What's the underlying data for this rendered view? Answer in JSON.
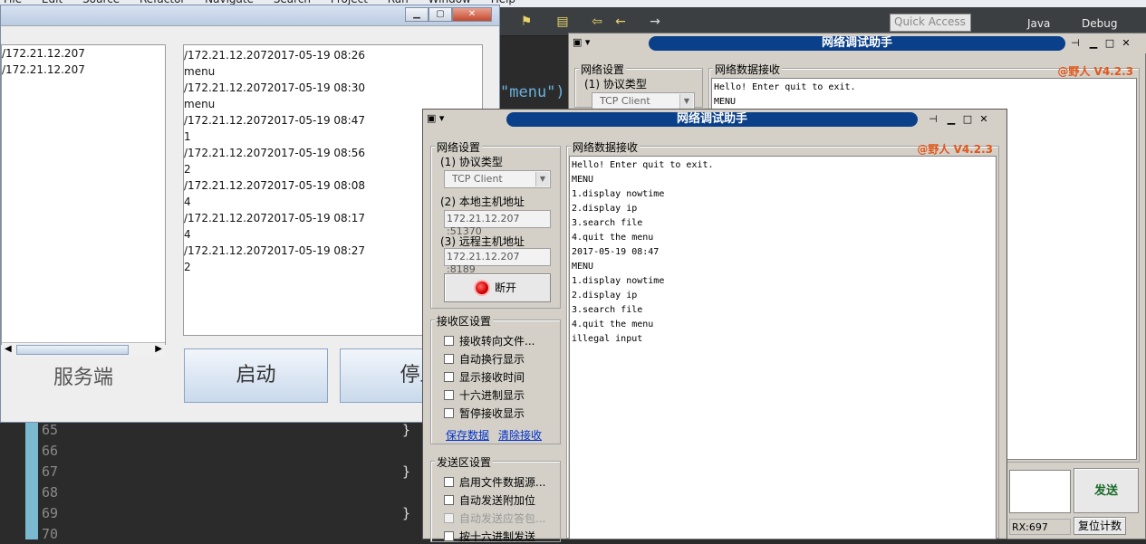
{
  "ide": {
    "menus": [
      "File",
      "Edit",
      "Source",
      "Refactor",
      "Navigate",
      "Search",
      "Project",
      "Run",
      "Window",
      "Help"
    ],
    "quick_access": "Quick Access",
    "perspective_java": "Java",
    "perspective_debug": "Debug",
    "code_literal": "\"menu\")",
    "line_numbers": [
      "65",
      "66",
      "67",
      "68",
      "69",
      "70"
    ],
    "brace": "}"
  },
  "server_app": {
    "clients": [
      "/172.21.12.207",
      "/172.21.12.207"
    ],
    "log": [
      "/172.21.12.2072017-05-19 08:26",
      "menu",
      "/172.21.12.2072017-05-19 08:30",
      "menu",
      "/172.21.12.2072017-05-19 08:47",
      "1",
      "/172.21.12.2072017-05-19 08:56",
      "2",
      "/172.21.12.2072017-05-19 08:08",
      "4",
      "/172.21.12.2072017-05-19 08:17",
      "4",
      "/172.21.12.2072017-05-19 08:27",
      "2"
    ],
    "server_label": "服务端",
    "start_button": "启动",
    "stop_button": "停止"
  },
  "rear_assistant": {
    "title": "网络调试助手",
    "network_settings": "网络设置",
    "protocol_label": "(1) 协议类型",
    "protocol_value": "TCP Client",
    "receive_title": "网络数据接收",
    "version": "@野人 V4.2.3",
    "received_lines": [
      "Hello! Enter quit to exit.",
      "MENU"
    ],
    "send_button": "发送",
    "rx_count": "RX:697",
    "reset_button": "复位计数"
  },
  "front_assistant": {
    "title": "网络调试助手",
    "network_settings": "网络设置",
    "protocol_label": "(1) 协议类型",
    "protocol_value": "TCP Client",
    "local_label": "(2) 本地主机地址",
    "local_value": "172.21.12.207 :51370",
    "remote_label": "(3) 远程主机地址",
    "remote_value": "172.21.12.207 :8189",
    "disconnect_button": "断开",
    "recv_settings": "接收区设置",
    "recv_options": [
      "接收转向文件...",
      "自动换行显示",
      "显示接收时间",
      "十六进制显示",
      "暂停接收显示"
    ],
    "save_data": "保存数据",
    "clear_recv": "清除接收",
    "send_settings": "发送区设置",
    "send_options": [
      "启用文件数据源...",
      "自动发送附加位",
      "自动发送应答包...",
      "按十六进制发送"
    ],
    "receive_title": "网络数据接收",
    "version": "@野人 V4.2.3",
    "received_lines": [
      "Hello! Enter quit to exit.",
      "MENU",
      "1.display nowtime",
      "2.display ip",
      "3.search file",
      "4.quit the menu",
      "2017-05-19 08:47",
      "MENU",
      "1.display nowtime",
      "2.display ip",
      "3.search file",
      "4.quit the menu",
      "illegal input"
    ]
  },
  "colors": {
    "version_orange": "#e0571a",
    "title_blue": "#0a3f8a",
    "link_blue": "#0033cc",
    "ide_dark": "#2b2b2b"
  },
  "icons": [
    "system-menu-icon",
    "pin-icon",
    "minimize-icon",
    "maximize-icon",
    "close-icon",
    "led-icon"
  ]
}
